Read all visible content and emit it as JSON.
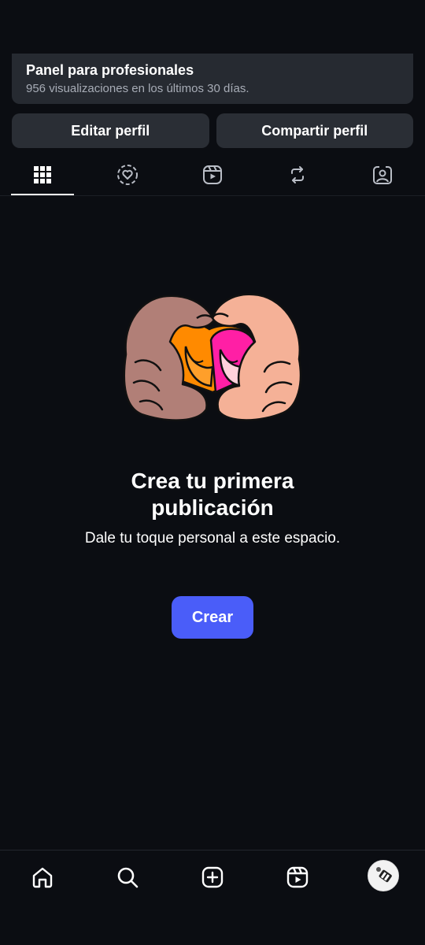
{
  "pro_panel": {
    "title": "Panel para profesionales",
    "subtitle": "956 visualizaciones en los últimos 30 días."
  },
  "actions": {
    "edit_label": "Editar perfil",
    "share_label": "Compartir perfil"
  },
  "tabs": [
    {
      "name": "grid-icon",
      "active": true
    },
    {
      "name": "heart-circle-icon",
      "active": false
    },
    {
      "name": "reels-icon",
      "active": false
    },
    {
      "name": "repost-icon",
      "active": false
    },
    {
      "name": "tagged-icon",
      "active": false
    }
  ],
  "empty_state": {
    "title_line1": "Crea tu primera",
    "title_line2": "publicación",
    "subtitle": "Dale tu toque personal a este espacio.",
    "button_label": "Crear"
  },
  "bottom_nav": [
    {
      "name": "home-icon"
    },
    {
      "name": "search-icon"
    },
    {
      "name": "create-icon"
    },
    {
      "name": "reels-icon"
    },
    {
      "name": "profile-avatar"
    }
  ],
  "colors": {
    "background": "#0b0d12",
    "card": "#262a31",
    "button": "#2a2e35",
    "accent": "#4a5df9"
  }
}
